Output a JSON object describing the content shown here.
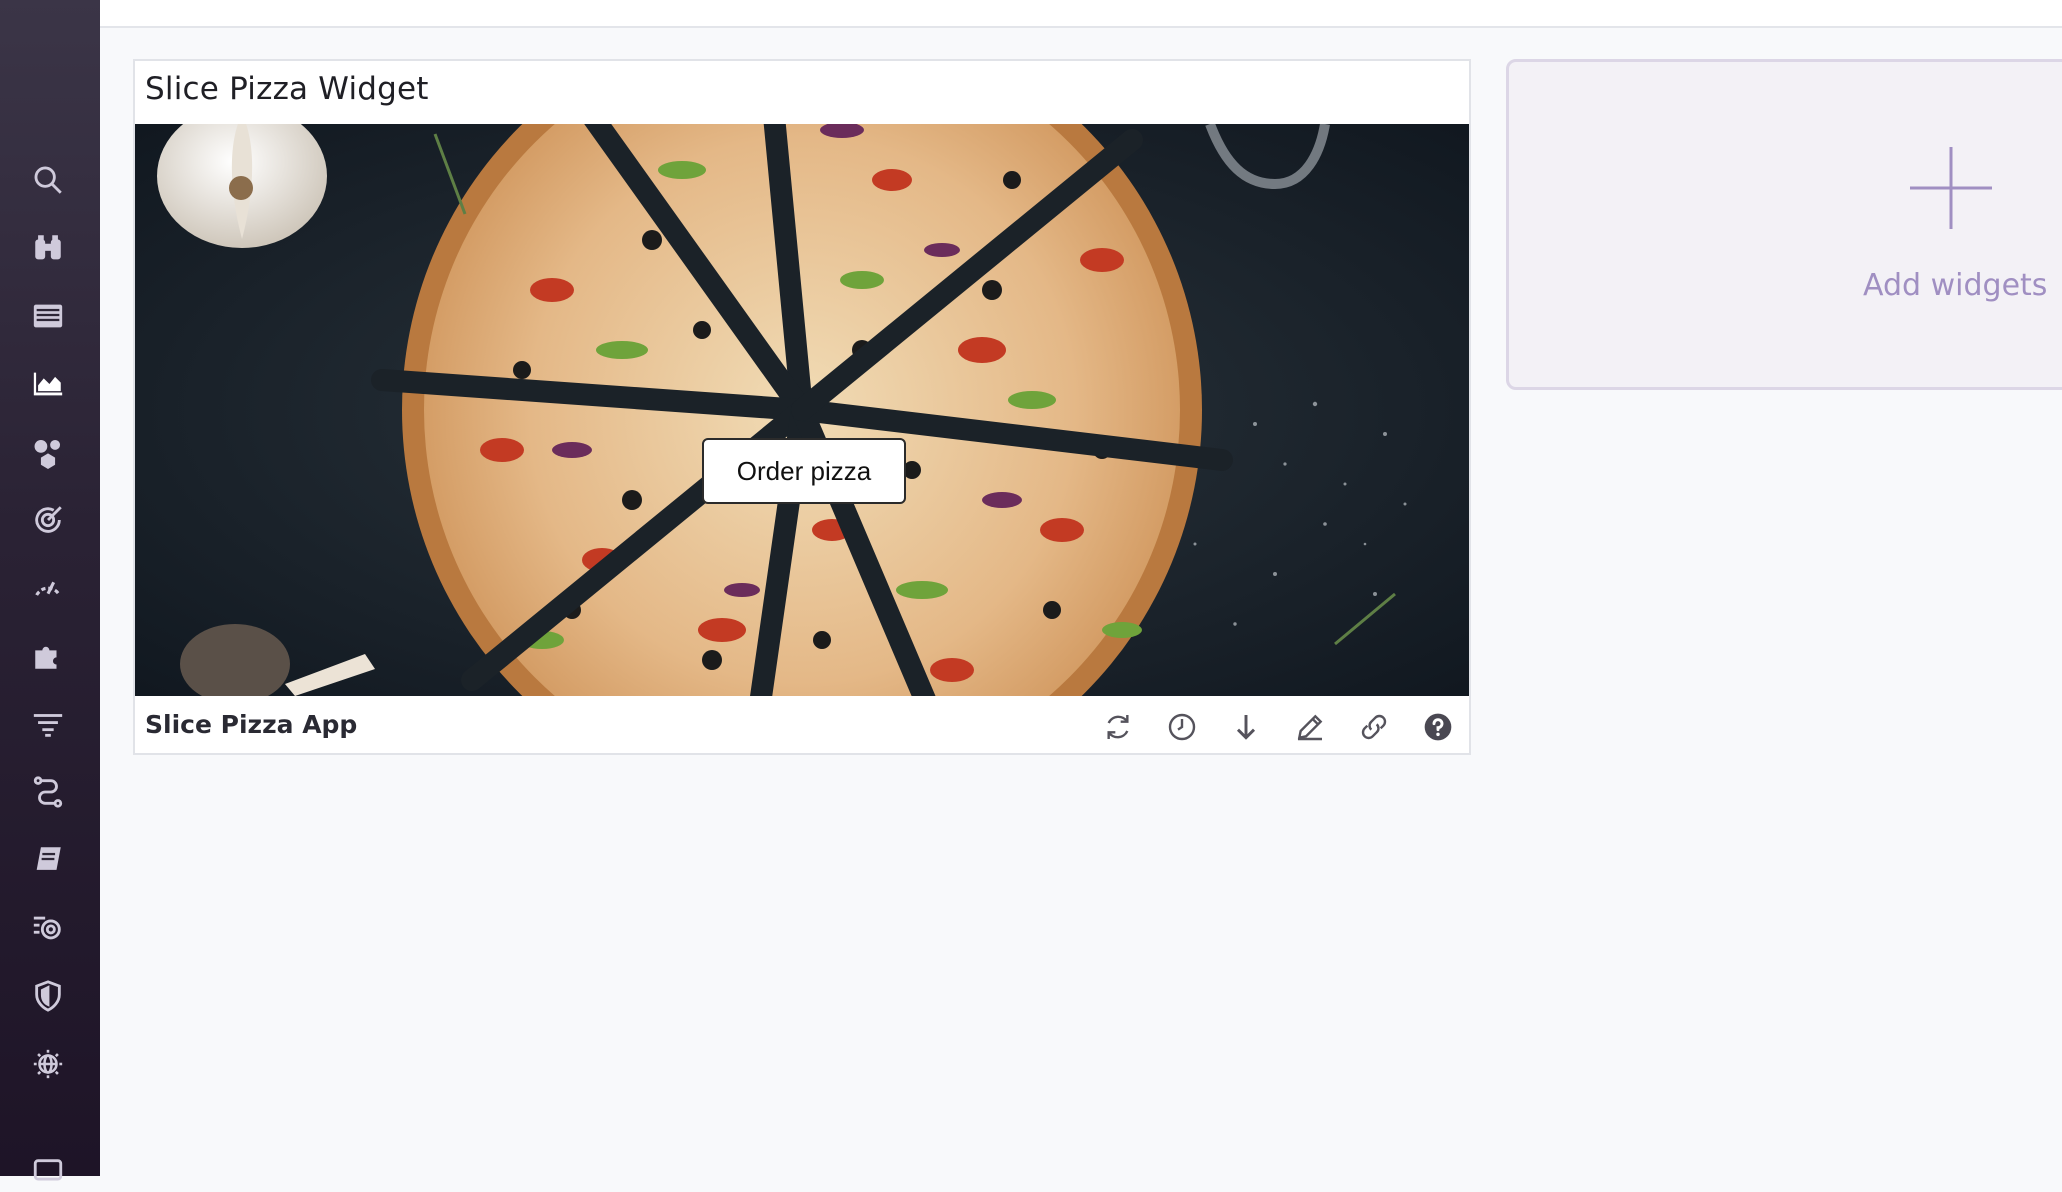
{
  "sidebar": {
    "icons": [
      {
        "name": "search-icon"
      },
      {
        "name": "binoculars-icon"
      },
      {
        "name": "list-icon"
      },
      {
        "name": "dashboard-chart-icon",
        "active": true
      },
      {
        "name": "infrastructure-icon"
      },
      {
        "name": "monitors-icon"
      },
      {
        "name": "gauge-icon"
      },
      {
        "name": "integrations-puzzle-icon"
      },
      {
        "name": "logs-filter-icon"
      },
      {
        "name": "apm-trace-icon"
      },
      {
        "name": "notebook-icon"
      },
      {
        "name": "watchdog-icon"
      },
      {
        "name": "security-shield-icon"
      },
      {
        "name": "synthetics-globe-icon"
      },
      {
        "name": "chat-icon"
      }
    ],
    "colors": {
      "active": "#ffffff",
      "inactive": "#cfcadb"
    }
  },
  "widget": {
    "title": "Slice Pizza Widget",
    "button_label": "Order pizza",
    "footer_title": "Slice Pizza App",
    "actions": [
      {
        "name": "refresh-icon"
      },
      {
        "name": "clock-icon"
      },
      {
        "name": "download-icon"
      },
      {
        "name": "edit-pencil-icon"
      },
      {
        "name": "link-icon"
      },
      {
        "name": "help-icon"
      }
    ]
  },
  "add_widgets": {
    "label": "Add widgets",
    "accent": "#a08fc2"
  }
}
